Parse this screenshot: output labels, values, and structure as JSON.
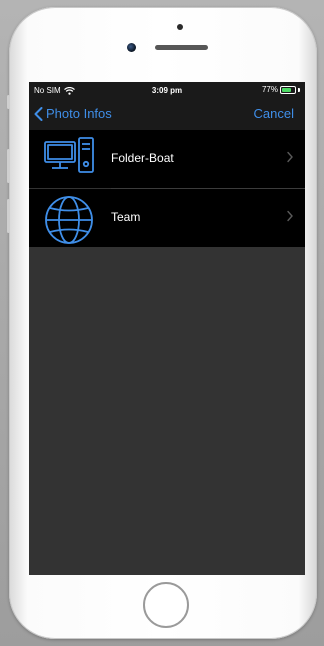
{
  "status_bar": {
    "carrier": "No SIM",
    "time": "3:09 pm",
    "battery": "77%",
    "battery_level": 0.77,
    "battery_color": "#4cd964"
  },
  "nav": {
    "back_label": "Photo Infos",
    "cancel_label": "Cancel",
    "accent_color": "#3f8ee8"
  },
  "list": {
    "items": [
      {
        "label": "Folder-Boat",
        "icon": "computer-icon"
      },
      {
        "label": "Team",
        "icon": "globe-icon"
      }
    ]
  },
  "colors": {
    "screen_background": "#333333",
    "row_background": "#000000",
    "icon_stroke": "#3f8ee8"
  }
}
